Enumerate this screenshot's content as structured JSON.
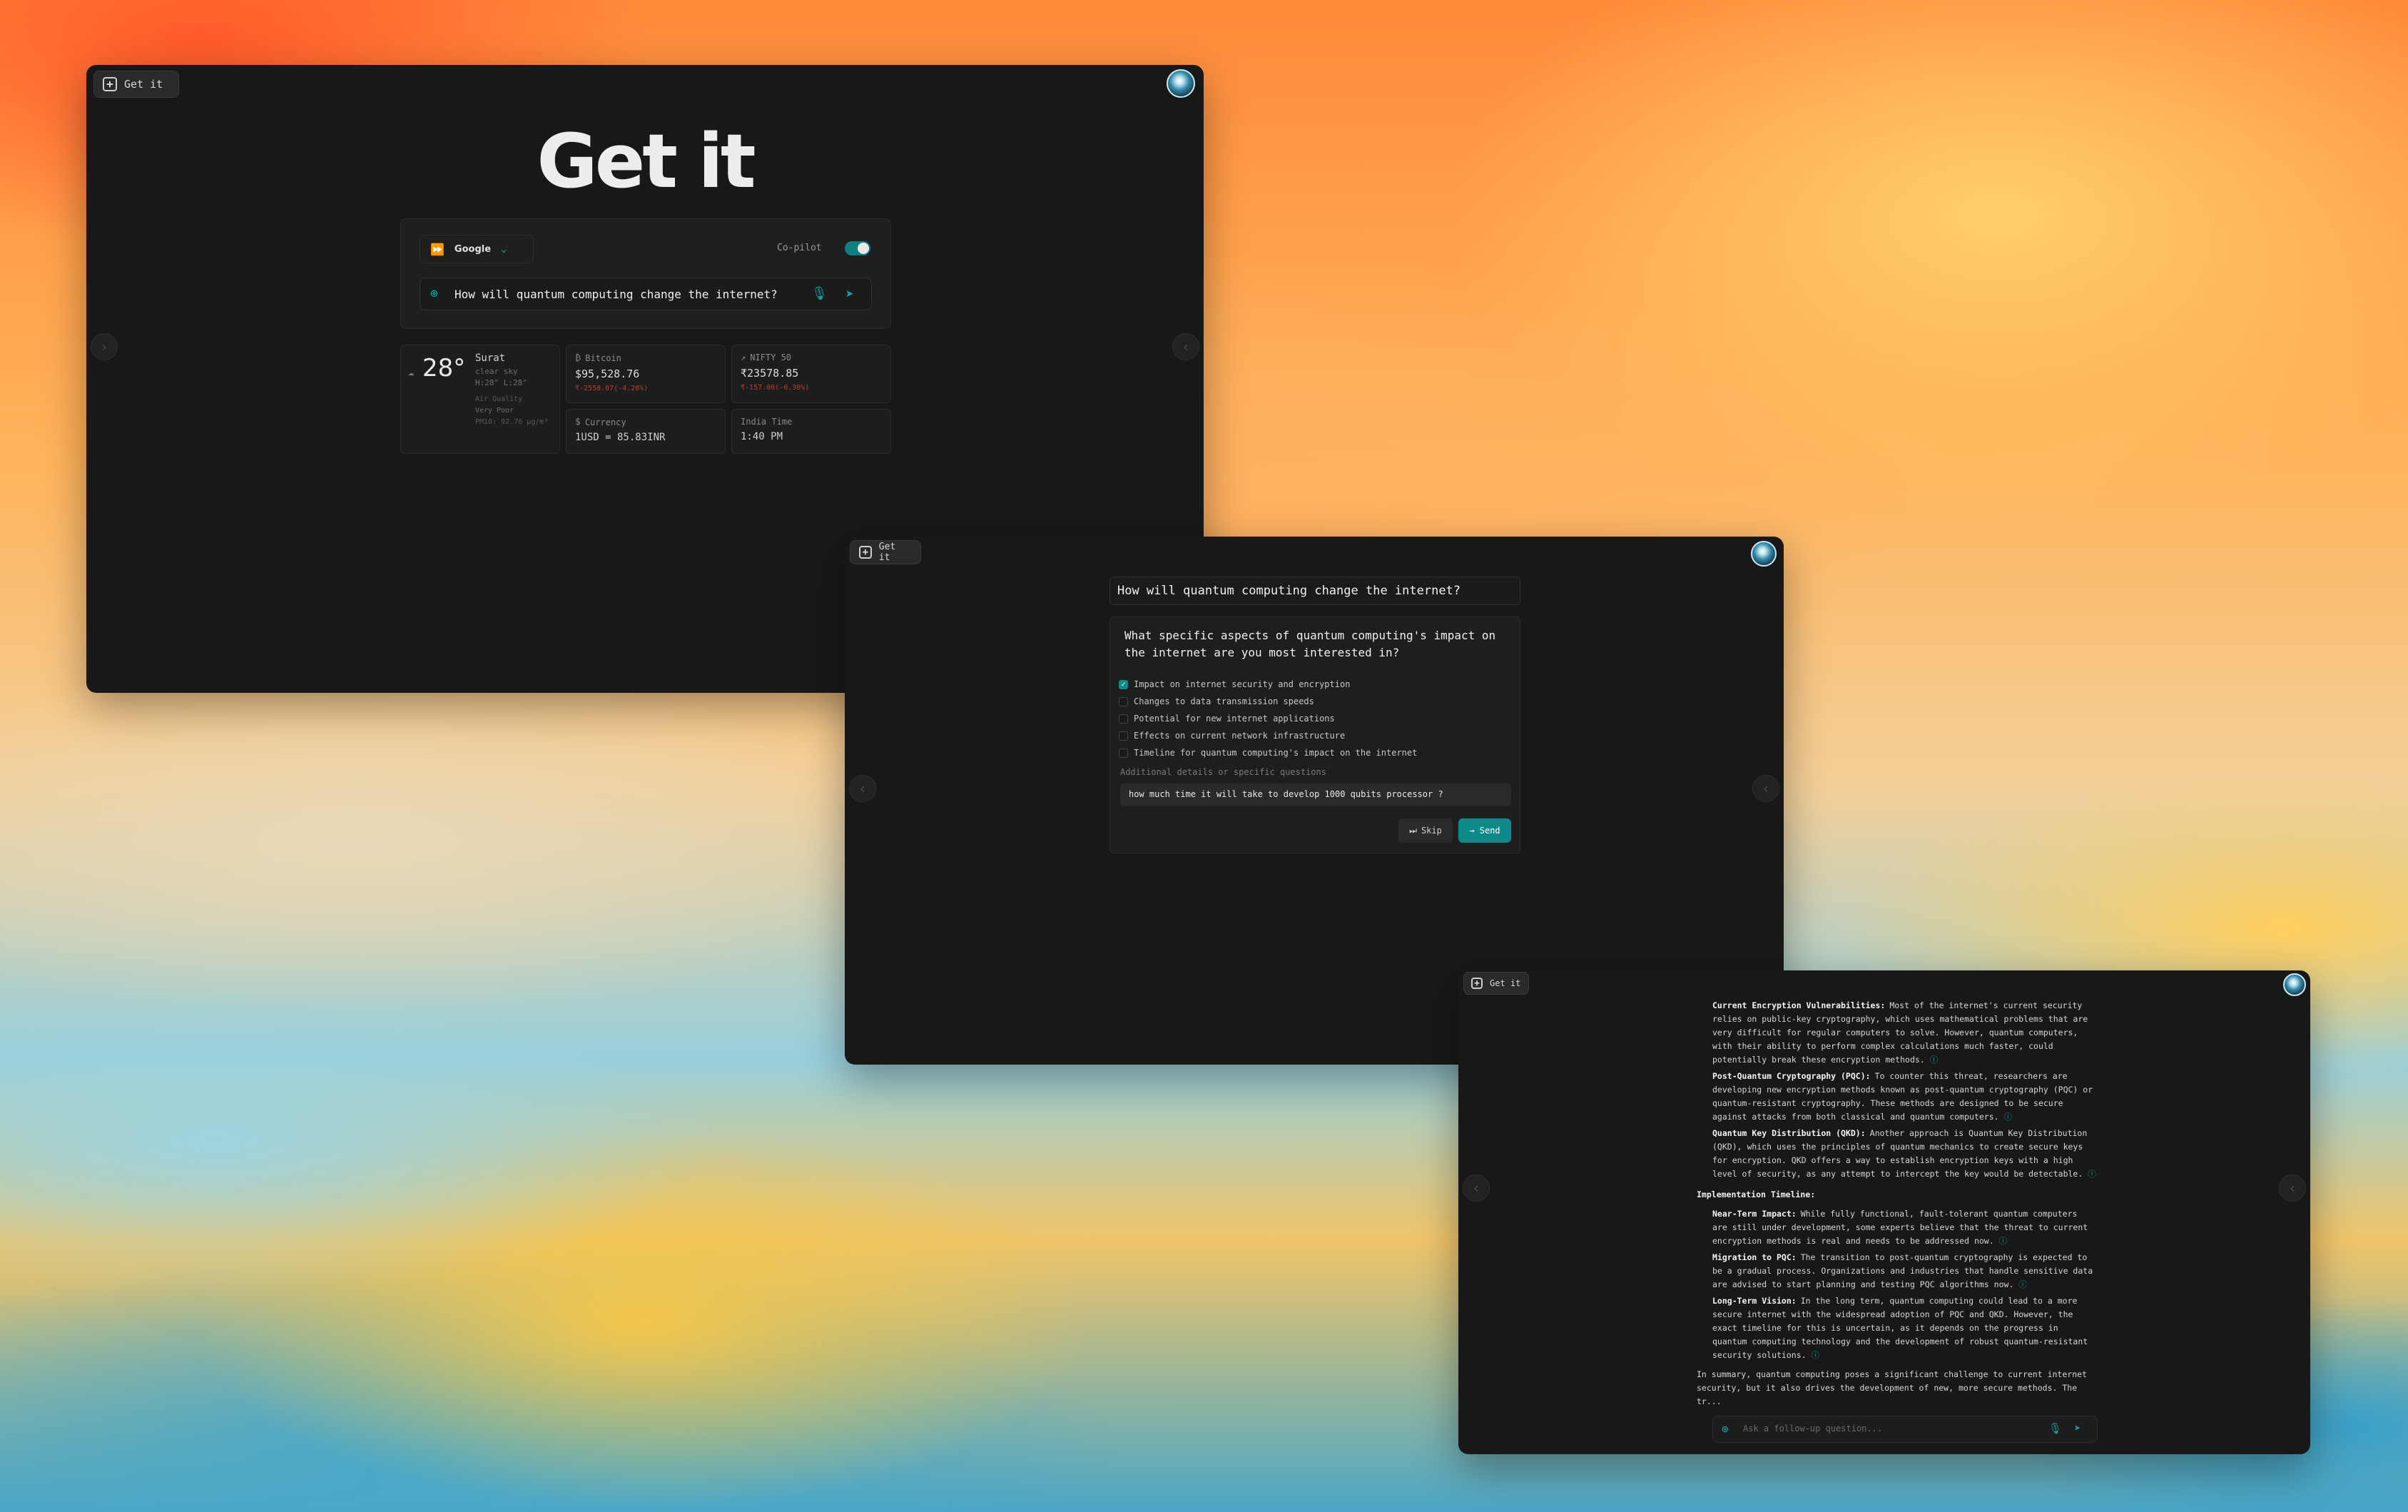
{
  "window1": {
    "get_it_button": "Get it",
    "logo": "Get it",
    "search": {
      "engine": "Google",
      "copilot_label": "Co-pilot",
      "copilot_on": true,
      "query": "How will quantum computing change the internet?"
    },
    "weather": {
      "temp": "28°",
      "city": "Surat",
      "condition": "clear sky",
      "range": "H:28° L:28°",
      "aq_label": "Air Quality",
      "aq_value": "Very Poor",
      "pm": "PM10: 92.76 µg/m³"
    },
    "bitcoin": {
      "label": "Bitcoin",
      "price": "$95,528.76",
      "change": "₹-2558.07(-4.20%)"
    },
    "nifty": {
      "label": "NIFTY 50",
      "price": "₹23578.85",
      "change": "₹-157.00(-0.30%)"
    },
    "currency": {
      "label": "Currency",
      "value": "1USD = 85.83INR"
    },
    "time": {
      "label": "India Time",
      "value": "1:40 PM"
    },
    "floating_button": "Get it"
  },
  "window2": {
    "query": "How will quantum computing change the internet?",
    "question": "What specific aspects of quantum computing's impact on the internet are you most interested in?",
    "options": [
      {
        "label": "Impact on internet security and encryption",
        "checked": true
      },
      {
        "label": "Changes to data transmission speeds",
        "checked": false
      },
      {
        "label": "Potential for new internet applications",
        "checked": false
      },
      {
        "label": "Effects on current network infrastructure",
        "checked": false
      },
      {
        "label": "Timeline for quantum computing's impact on the internet",
        "checked": false
      }
    ],
    "details_label": "Additional details or specific questions",
    "details_value": "how much time it will take to develop 1000 qubits processor ?",
    "skip_label": "Skip",
    "send_label": "→ Send",
    "floating_button": "Get it"
  },
  "window3": {
    "items1": [
      {
        "title": "Current Encryption Vulnerabilities:",
        "text": "Most of the internet's current security relies on public-key cryptography, which uses mathematical problems that are very difficult for regular computers to solve. However, quantum computers, with their ability to perform complex calculations much faster, could potentially break these encryption methods."
      },
      {
        "title": "Post-Quantum Cryptography (PQC):",
        "text": "To counter this threat, researchers are developing new encryption methods known as post-quantum cryptography (PQC) or quantum-resistant cryptography. These methods are designed to be secure against attacks from both classical and quantum computers."
      },
      {
        "title": "Quantum Key Distribution (QKD):",
        "text": "Another approach is Quantum Key Distribution (QKD), which uses the principles of quantum mechanics to create secure keys for encryption. QKD offers a way to establish encryption keys with a high level of security, as any attempt to intercept the key would be detectable."
      }
    ],
    "section_heading": "Implementation Timeline:",
    "items2": [
      {
        "title": "Near-Term Impact:",
        "text": "While fully functional, fault-tolerant quantum computers are still under development, some experts believe that the threat to current encryption methods is real and needs to be addressed now."
      },
      {
        "title": "Migration to PQC:",
        "text": "The transition to post-quantum cryptography is expected to be a gradual process. Organizations and industries that handle sensitive data are advised to start planning and testing PQC algorithms now."
      },
      {
        "title": "Long-Term Vision:",
        "text": "In the long term, quantum computing could lead to a more secure internet with the widespread adoption of PQC and QKD. However, the exact timeline for this is uncertain, as it depends on the progress in quantum computing technology and the development of robust quantum-resistant security solutions."
      }
    ],
    "summary": "In summary, quantum computing poses a significant challenge to current internet security, but it also drives the development of new, more secure methods. The tr...",
    "followup_placeholder": "Ask a follow-up question..."
  },
  "colors": {
    "accent": "#13a1a1",
    "window_bg": "#181818",
    "card_bg": "#1d1d1d",
    "negative": "#c0392b"
  }
}
